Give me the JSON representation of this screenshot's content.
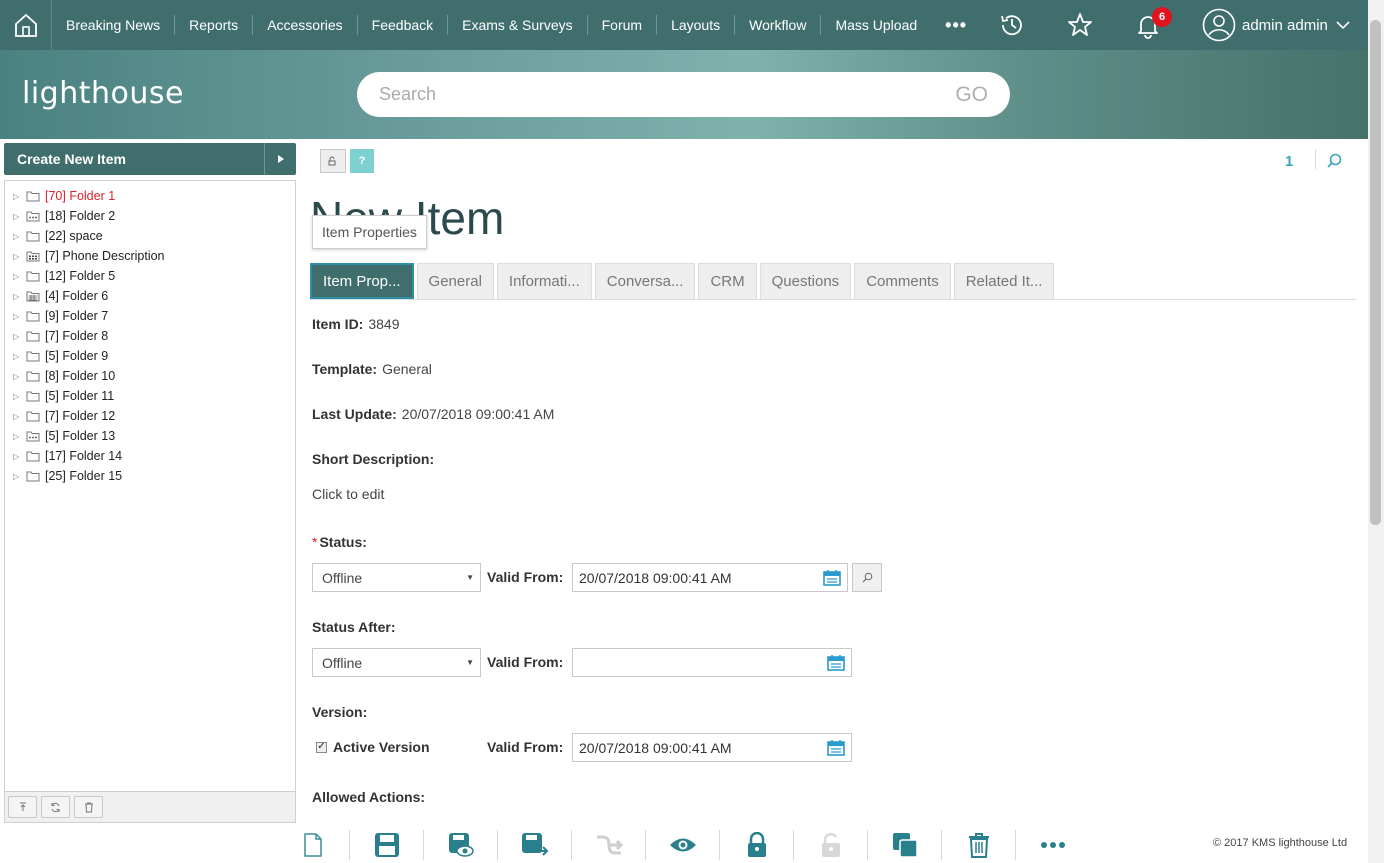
{
  "topnav": {
    "items": [
      "Breaking News",
      "Reports",
      "Accessories",
      "Feedback",
      "Exams & Surveys",
      "Forum",
      "Layouts",
      "Workflow",
      "Mass Upload"
    ],
    "more": "•••",
    "notification_count": "6",
    "user_name": "admin admin"
  },
  "banner": {
    "logo": "lighthouse",
    "search_placeholder": "Search",
    "go": "GO"
  },
  "sidebar": {
    "create_label": "Create New Item",
    "tree": [
      {
        "label": "[70] Folder 1",
        "icon": "folder-icon",
        "highlight": true
      },
      {
        "label": "[18] Folder 2",
        "icon": "dots-folder-icon",
        "highlight": false
      },
      {
        "label": "[22] space",
        "icon": "folder-icon",
        "highlight": false
      },
      {
        "label": "[7] Phone Description",
        "icon": "grid-folder-icon",
        "highlight": false
      },
      {
        "label": "[12] Folder 5",
        "icon": "folder-icon",
        "highlight": false
      },
      {
        "label": "[4] Folder 6",
        "icon": "calendar-folder-icon",
        "highlight": false
      },
      {
        "label": "[9] Folder 7",
        "icon": "folder-icon",
        "highlight": false
      },
      {
        "label": "[7] Folder 8",
        "icon": "folder-icon",
        "highlight": false
      },
      {
        "label": "[5] Folder 9",
        "icon": "folder-icon",
        "highlight": false
      },
      {
        "label": "[8] Folder 10",
        "icon": "folder-icon",
        "highlight": false
      },
      {
        "label": "[5] Folder 11",
        "icon": "folder-icon",
        "highlight": false
      },
      {
        "label": "[7] Folder 12",
        "icon": "folder-icon",
        "highlight": false
      },
      {
        "label": "[5] Folder 13",
        "icon": "dots-folder-icon",
        "highlight": false
      },
      {
        "label": "[17] Folder 14",
        "icon": "folder-icon",
        "highlight": false
      },
      {
        "label": "[25] Folder 15",
        "icon": "folder-icon",
        "highlight": false
      }
    ]
  },
  "main": {
    "page_number": "1",
    "help_label": "?",
    "title": "New Item",
    "tooltip": "Item Properties",
    "tabs": [
      "Item Prop...",
      "General",
      "Informati...",
      "Conversa...",
      "CRM",
      "Questions",
      "Comments",
      "Related It..."
    ],
    "fields": {
      "item_id_label": "Item ID:",
      "item_id": "3849",
      "template_label": "Template:",
      "template": "General",
      "last_update_label": "Last Update:",
      "last_update": "20/07/2018 09:00:41 AM",
      "short_desc_label": "Short Description:",
      "short_desc": "Click to edit",
      "status_label": "Status:",
      "status_value": "Offline",
      "valid_from_label": "Valid From:",
      "status_valid_from": "20/07/2018 09:00:41 AM",
      "status_after_label": "Status After:",
      "status_after_value": "Offline",
      "status_after_valid_from": "",
      "version_label": "Version:",
      "active_version_label": "Active Version",
      "version_valid_from": "20/07/2018 09:00:41 AM",
      "allowed_actions_label": "Allowed Actions:"
    }
  },
  "footer": {
    "copyright": "© 2017 KMS lighthouse Ltd"
  },
  "colors": {
    "brand": "#3f6e6d",
    "accent": "#2f8da5",
    "link": "#3aa6b9",
    "badge": "#e0141c"
  }
}
